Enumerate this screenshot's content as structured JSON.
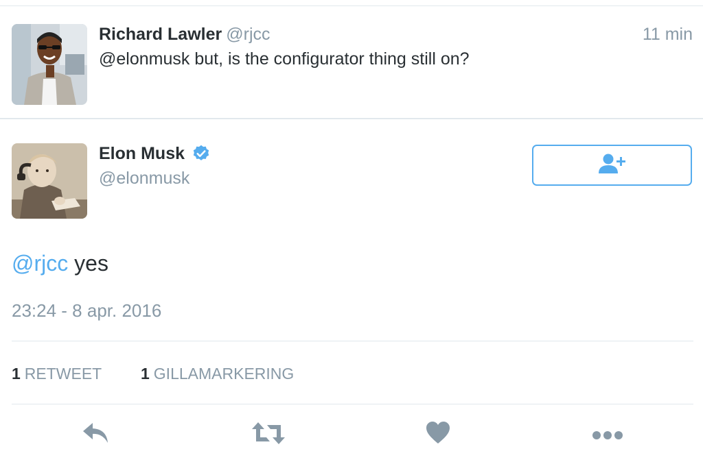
{
  "reply_tweet": {
    "name": "Richard Lawler",
    "handle": "@rjcc",
    "time": "11 min",
    "text": "@elonmusk but, is the configurator thing still on?"
  },
  "main_tweet": {
    "name": "Elon Musk",
    "handle": "@elonmusk",
    "verified_icon": "verified-badge-icon",
    "follow_button_icon": "follow-user-plus-icon",
    "text_mention": "@rjcc",
    "text_body": " yes",
    "timestamp": "23:24 - 8 apr. 2016",
    "stats": {
      "retweet_count": "1",
      "retweet_label": "RETWEET",
      "like_count": "1",
      "like_label": "GILLAMARKERING"
    }
  },
  "actions": [
    "reply-icon",
    "retweet-icon",
    "like-heart-icon",
    "more-icon"
  ],
  "colors": {
    "accent": "#55acee",
    "text": "#292f33",
    "muted": "#8899a6",
    "divider": "#e1e8ed",
    "action_icon": "#8899a6"
  }
}
